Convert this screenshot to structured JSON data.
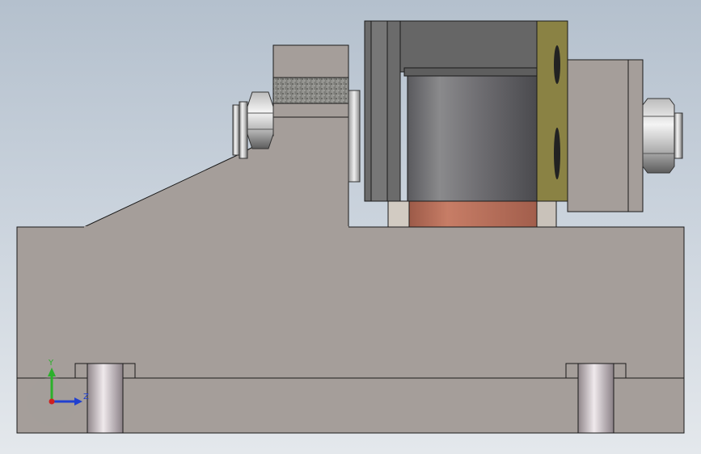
{
  "viewport": {
    "background_top": "#b4c0cd",
    "background_bottom": "#e4e8ec"
  },
  "model": {
    "body_color": "#a59e9a",
    "edge_color": "#1a1a1a",
    "plate_color": "#8a8244",
    "copper_color": "#b56d5a",
    "housing_color": "#6b6b6b",
    "knurl_color": "#8c8c88"
  },
  "triad": {
    "y_label": "Y",
    "z_label": "Z",
    "y_color": "#2bb02b",
    "z_color": "#2040d0",
    "x_color": "#d02020"
  }
}
